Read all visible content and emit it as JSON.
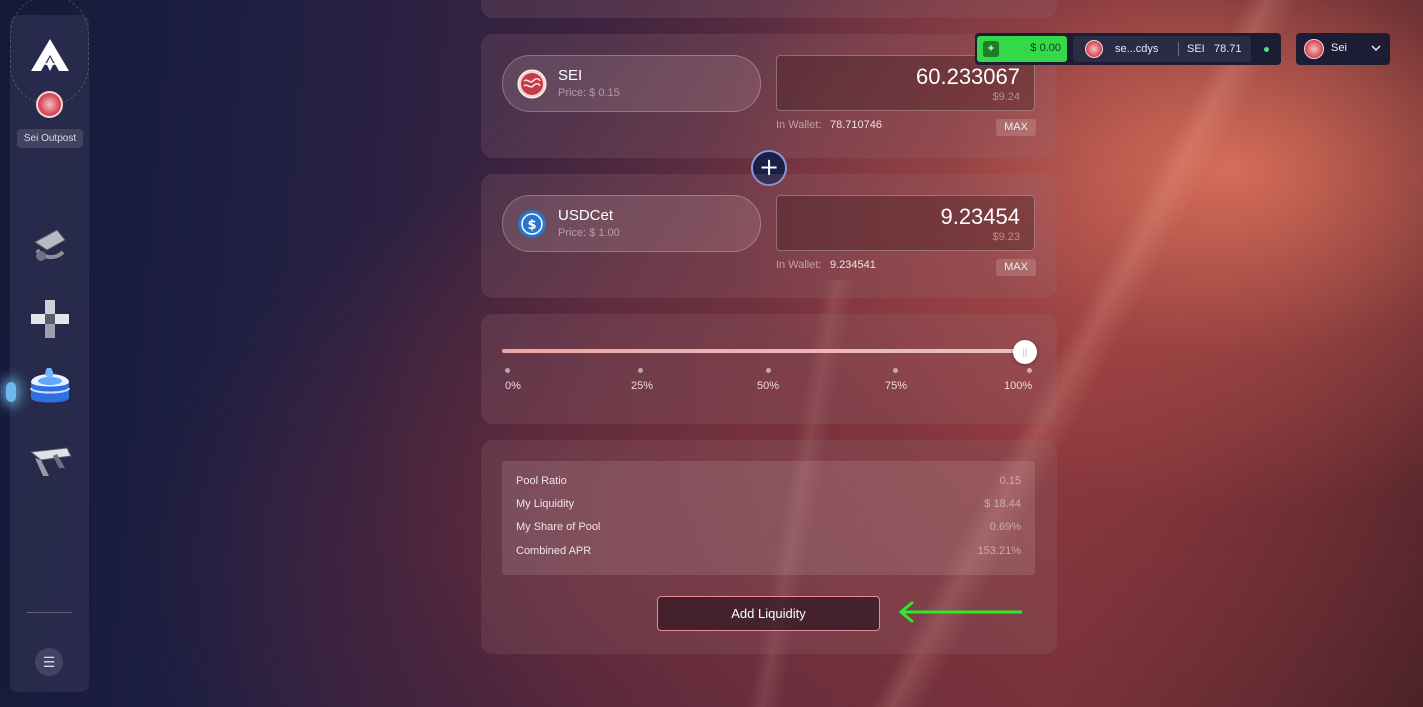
{
  "sidebar": {
    "chain_label": "Sei Outpost",
    "nav_items": [
      {
        "icon": "swap-icon"
      },
      {
        "icon": "pools-icon"
      },
      {
        "icon": "liquidity-icon",
        "active": true
      },
      {
        "icon": "bridge-icon"
      }
    ],
    "menu_icon": "☰"
  },
  "header": {
    "balance": "$ 0.00",
    "address": "se...cdys",
    "token": "SEI",
    "token_amount": "78.71",
    "network": "Sei"
  },
  "tokens": [
    {
      "name": "SEI",
      "price": "Price: $ 0.15",
      "amount": "60.233067",
      "amount_usd": "$9.24",
      "wallet_label": "In Wallet:",
      "wallet_value": "78.710746",
      "max_label": "MAX"
    },
    {
      "name": "USDCet",
      "price": "Price: $ 1.00",
      "amount": "9.23454",
      "amount_usd": "$9.23",
      "wallet_label": "In Wallet:",
      "wallet_value": "9.234541",
      "max_label": "MAX"
    }
  ],
  "plus_symbol": "+",
  "slider": {
    "value_percent": 100,
    "ticks": [
      "0%",
      "25%",
      "50%",
      "75%",
      "100%"
    ]
  },
  "info": {
    "rows": [
      {
        "label": "Pool Ratio",
        "value": "0.15"
      },
      {
        "label": "My Liquidity",
        "value": "$ 18.44"
      },
      {
        "label": "My Share of Pool",
        "value": "0.69%"
      },
      {
        "label": "Combined APR",
        "value": "153.21%"
      }
    ]
  },
  "actions": {
    "add_liquidity_label": "Add Liquidity"
  },
  "colors": {
    "accent_green": "#34d94a",
    "button_border": "#e98a98",
    "arrow": "#2ee82a"
  }
}
